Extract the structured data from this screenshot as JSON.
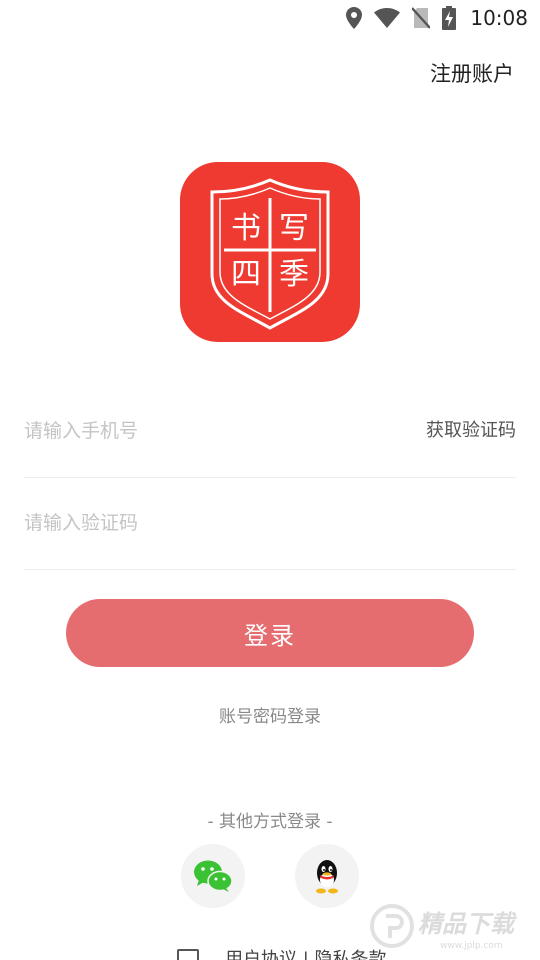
{
  "status_bar": {
    "time": "10:08",
    "icons": [
      "location-icon",
      "wifi-icon",
      "no-sim-icon",
      "battery-charging-icon"
    ]
  },
  "header": {
    "register_label": "注册账户"
  },
  "logo": {
    "characters": [
      "书",
      "写",
      "四",
      "季"
    ],
    "background_color": "#ee3a30"
  },
  "form": {
    "phone_placeholder": "请输入手机号",
    "phone_value": "",
    "get_code_label": "获取验证码",
    "code_placeholder": "请输入验证码",
    "code_value": ""
  },
  "login_button": {
    "label": "登录",
    "color": "#e56d70"
  },
  "account_login_label": "账号密码登录",
  "other_login_label": "- 其他方式登录 -",
  "social": {
    "wechat_icon": "wechat-icon",
    "qq_icon": "qq-icon"
  },
  "agreement": {
    "text": "用户协议 | 隐私条款",
    "checked": false
  },
  "watermark": {
    "text": "精品下载",
    "subtext": "www.jplp.com"
  }
}
